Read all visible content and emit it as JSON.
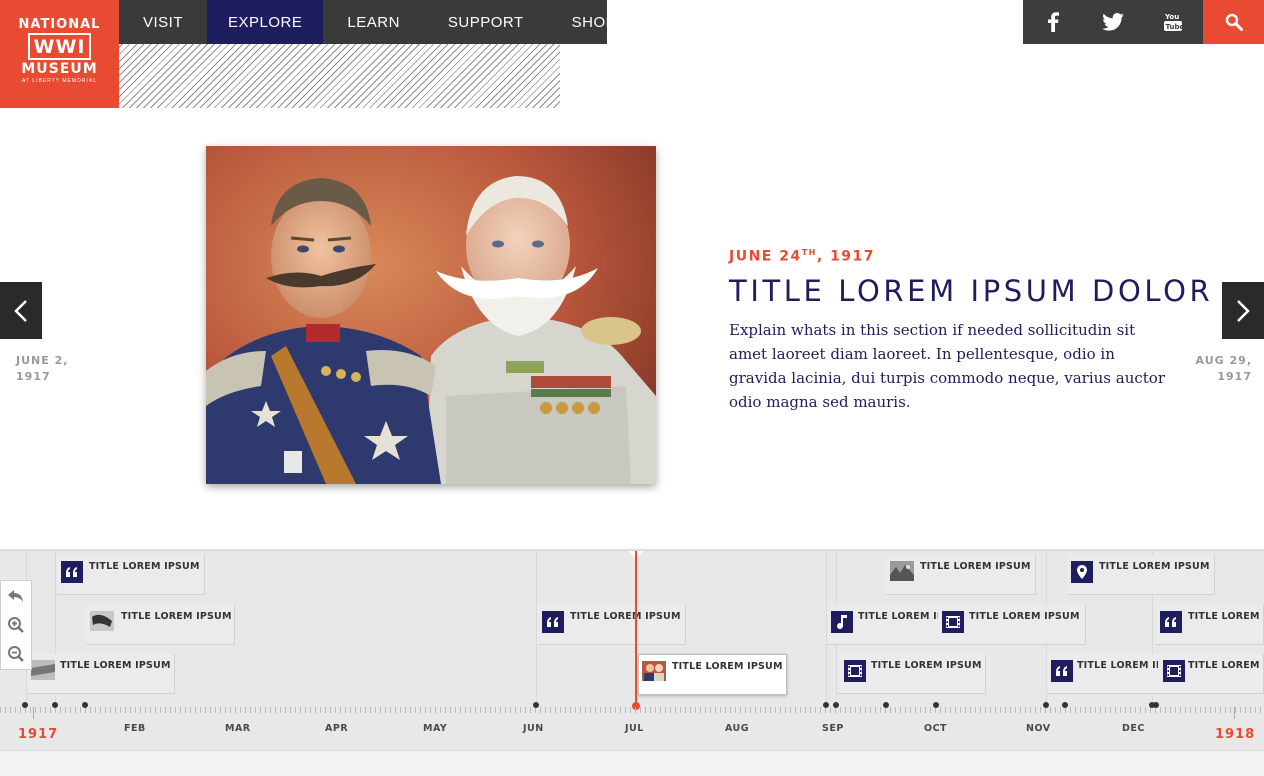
{
  "logo": {
    "line1": "NATIONAL",
    "line2": "WWI",
    "line3": "MUSEUM",
    "line4": "AT LIBERTY MEMORIAL"
  },
  "nav": {
    "visit": "VISIT",
    "explore": "EXPLORE",
    "learn": "LEARN",
    "support": "SUPPORT",
    "shop": "SHOP",
    "active": "EXPLORE"
  },
  "social": [
    "facebook-icon",
    "twitter-icon",
    "youtube-icon"
  ],
  "hero": {
    "date_main": "JUNE 24",
    "date_sup": "TH",
    "date_tail": ", 1917",
    "title": "TITLE LOREM IPSUM DOLOR",
    "description": "Explain whats in this section if needed sollicitudin sit amet laoreet diam laoreet. In pellentesque, odio in gravida lacinia, dui turpis commodo neque, varius auctor odio magna sed mauris."
  },
  "prev": {
    "line1": "JUNE 2,",
    "line2": "1917"
  },
  "next": {
    "line1": "AUG 29,",
    "line2": "1917"
  },
  "timeline": {
    "months": [
      "FEB",
      "MAR",
      "APR",
      "MAY",
      "JUN",
      "JUL",
      "AUG",
      "SEP",
      "OCT",
      "NOV",
      "DEC"
    ],
    "year_start": "1917",
    "year_end": "1918",
    "cards": [
      {
        "label": "TITLE LOREM IPSUM",
        "icon": "quote-icon"
      },
      {
        "label": "TITLE LOREM IPSUM",
        "icon": "photo-thumbnail"
      },
      {
        "label": "TITLE LOREM IPSUM",
        "icon": "photo-thumbnail"
      },
      {
        "label": "TITLE LOREM IPSUM",
        "icon": "quote-icon"
      },
      {
        "label": "TITLE LOREM IPSUM",
        "icon": "photo-thumbnail"
      },
      {
        "label": "TITLE LOREM IPSUM",
        "icon": "photo-thumbnail"
      },
      {
        "label": "TITLE LOREM IPSUM",
        "icon": "location-pin-icon"
      },
      {
        "label": "TITLE LOREM IPS",
        "icon": "music-note-icon"
      },
      {
        "label": "TITLE LOREM IPSUM",
        "icon": "film-icon"
      },
      {
        "label": "TITLE LOREM IPSUM",
        "icon": "film-icon"
      },
      {
        "label": "TITLE LOREM IPS",
        "icon": "quote-icon"
      },
      {
        "label": "TITLE LOREM IPS",
        "icon": "quote-icon"
      },
      {
        "label": "TITLE LOREM IPS",
        "icon": "film-icon"
      }
    ]
  },
  "colors": {
    "brand_red": "#e84a32",
    "navy": "#1e1d5e",
    "nav_bg": "#3a3a3a"
  }
}
